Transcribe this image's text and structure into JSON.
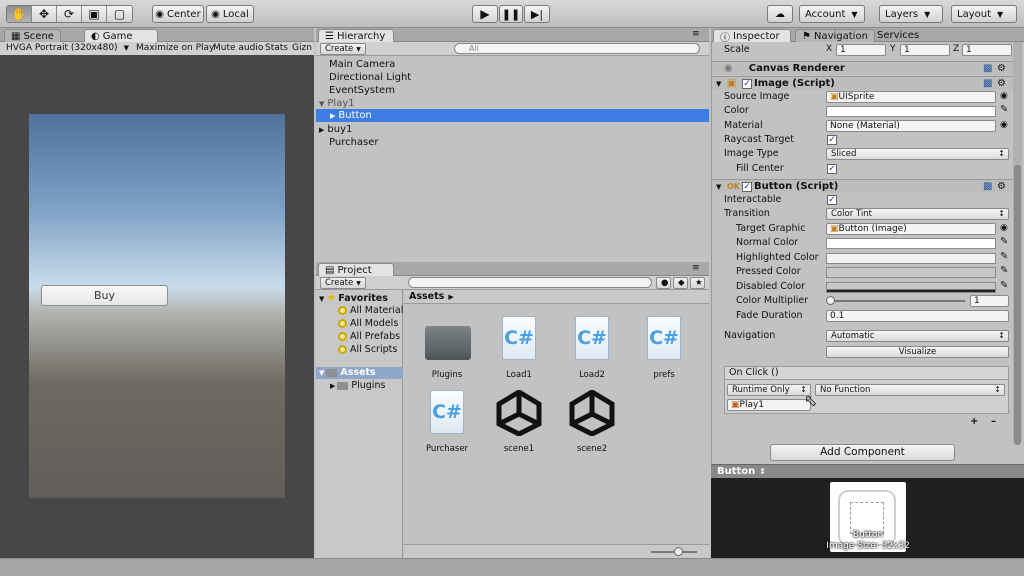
{
  "toolbar": {
    "center_label": "Center",
    "local_label": "Local",
    "account_label": "Account",
    "layers_label": "Layers",
    "layout_label": "Layout"
  },
  "scene_panel": {
    "tab_scene": "Scene",
    "tab_game": "Game",
    "resolution": "HVGA Portrait (320x480)",
    "maximize_on_play": "Maximize on Play",
    "mute_audio": "Mute audio",
    "stats": "Stats",
    "gizmos": "Gizn",
    "buy_button": "Buy"
  },
  "hierarchy": {
    "tab": "Hierarchy",
    "create": "Create",
    "search_placeholder": "All",
    "items": [
      "Main Camera",
      "Directional Light",
      "EventSystem",
      "Play1",
      "Button",
      "buy1",
      "Purchaser"
    ]
  },
  "project": {
    "tab": "Project",
    "create": "Create",
    "favorites": "Favorites",
    "favorites_items": [
      "All Material",
      "All Models",
      "All Prefabs",
      "All Scripts"
    ],
    "assets_label": "Assets",
    "plugins_label": "Plugins",
    "breadcrumb": "Assets",
    "assets": [
      {
        "name": "Plugins",
        "icon": "folder-icon"
      },
      {
        "name": "Load1",
        "icon": "csharp-script-icon"
      },
      {
        "name": "Load2",
        "icon": "csharp-script-icon"
      },
      {
        "name": "prefs",
        "icon": "csharp-script-icon"
      },
      {
        "name": "Purchaser",
        "icon": "csharp-script-icon"
      },
      {
        "name": "scene1",
        "icon": "unity-scene-icon"
      },
      {
        "name": "scene2",
        "icon": "unity-scene-icon"
      }
    ]
  },
  "inspector": {
    "tab_inspector": "Inspector",
    "tab_navigation": "Navigation",
    "tab_services": "Services",
    "scale_label": "Scale",
    "scale": {
      "x": "1",
      "y": "1",
      "z": "1"
    },
    "canvas_renderer": "Canvas Renderer",
    "image_script": "Image (Script)",
    "source_image_label": "Source Image",
    "source_image_value": "UISprite",
    "color_label": "Color",
    "material_label": "Material",
    "material_value": "None (Material)",
    "raycast_target_label": "Raycast Target",
    "image_type_label": "Image Type",
    "image_type_value": "Sliced",
    "fill_center_label": "Fill Center",
    "button_script": "Button (Script)",
    "interactable_label": "Interactable",
    "transition_label": "Transition",
    "transition_value": "Color Tint",
    "target_graphic_label": "Target Graphic",
    "target_graphic_value": "Button (Image)",
    "normal_color_label": "Normal Color",
    "highlighted_color_label": "Highlighted Color",
    "pressed_color_label": "Pressed Color",
    "disabled_color_label": "Disabled Color",
    "color_multiplier_label": "Color Multiplier",
    "color_multiplier_value": "1",
    "fade_duration_label": "Fade Duration",
    "fade_duration_value": "0.1",
    "navigation_label": "Navigation",
    "navigation_value": "Automatic",
    "visualize_label": "Visualize",
    "onclick_label": "On Click ()",
    "runtime_value": "Runtime Only",
    "function_value": "No Function",
    "object_value": "Play1",
    "add_component": "Add Component"
  },
  "preview": {
    "title": "Button",
    "caption_name": "Button",
    "caption_size": "Image Size: 32x32"
  }
}
